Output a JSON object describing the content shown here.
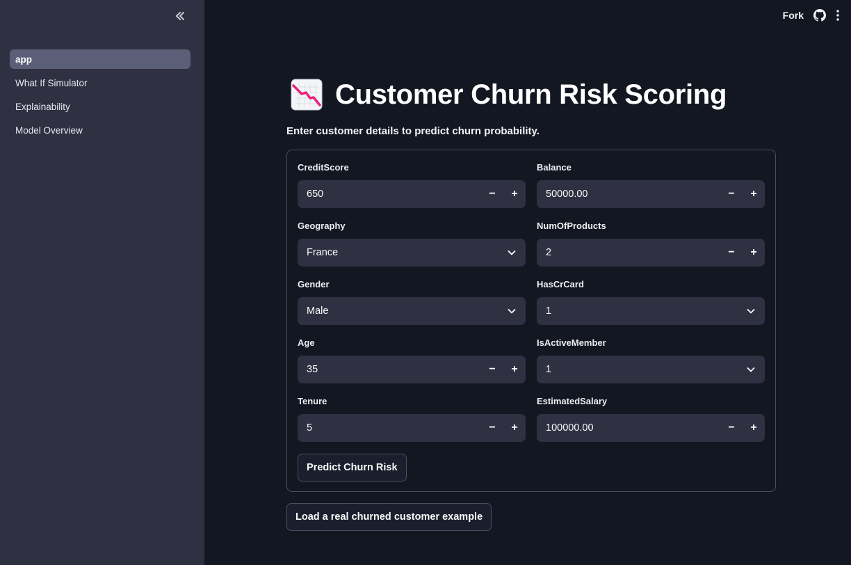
{
  "sidebar": {
    "items": [
      {
        "label": "app",
        "active": true
      },
      {
        "label": "What If Simulator",
        "active": false
      },
      {
        "label": "Explainability",
        "active": false
      },
      {
        "label": "Model Overview",
        "active": false
      }
    ],
    "collapse_icon": "double-chevron-left-icon"
  },
  "topbar": {
    "fork_label": "Fork",
    "github_icon": "github-icon",
    "menu_icon": "kebab-menu-icon"
  },
  "main": {
    "title": "Customer Churn Risk Scoring",
    "title_icon": "chart-decreasing-icon",
    "subtitle": "Enter customer details to predict churn probability."
  },
  "form": {
    "credit_score": {
      "label": "CreditScore",
      "value": "650"
    },
    "balance": {
      "label": "Balance",
      "value": "50000.00"
    },
    "geography": {
      "label": "Geography",
      "value": "France"
    },
    "num_products": {
      "label": "NumOfProducts",
      "value": "2"
    },
    "gender": {
      "label": "Gender",
      "value": "Male"
    },
    "has_cr_card": {
      "label": "HasCrCard",
      "value": "1"
    },
    "age": {
      "label": "Age",
      "value": "35"
    },
    "is_active_member": {
      "label": "IsActiveMember",
      "value": "1"
    },
    "tenure": {
      "label": "Tenure",
      "value": "5"
    },
    "estimated_salary": {
      "label": "EstimatedSalary",
      "value": "100000.00"
    },
    "stepper_minus": "−",
    "stepper_plus": "+",
    "predict_label": "Predict Churn Risk"
  },
  "example_button_label": "Load a real churned customer example",
  "colors": {
    "app_bg": "#131722",
    "sidebar_bg": "#2f3142",
    "input_bg": "#2f3142",
    "active_nav_bg": "#5a5e77",
    "border": "#4a4e5e",
    "emoji_line": "#e8217a"
  }
}
